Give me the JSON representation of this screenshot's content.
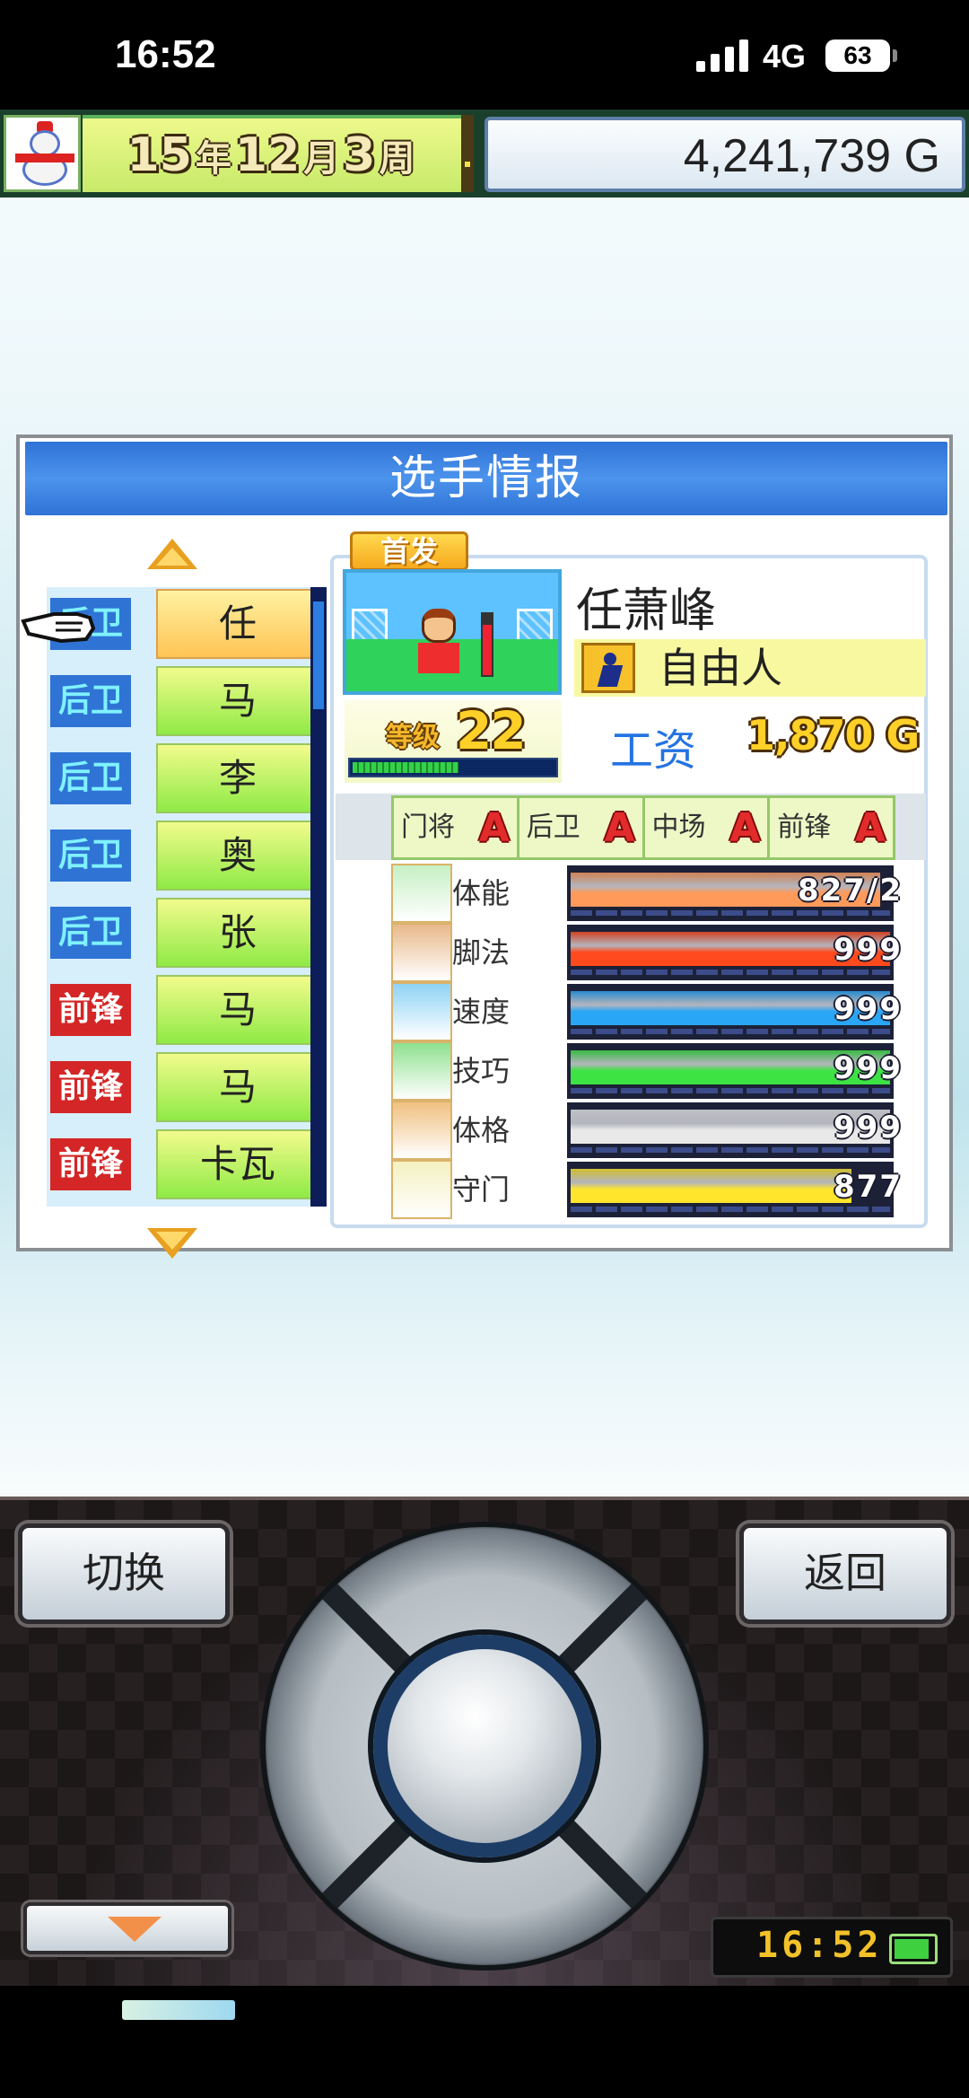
{
  "status_bar": {
    "time": "16:52",
    "network": "4G",
    "battery": "63"
  },
  "top_bar": {
    "year_num": "15",
    "year_unit": "年",
    "month_num": "12",
    "month_unit": "月",
    "week_num": "3",
    "week_unit": "周",
    "money": "4,241,739 G",
    "avatar_icon": "snowman-avatar-icon"
  },
  "window": {
    "title": "选手情报"
  },
  "roster": [
    {
      "position": "后卫",
      "name": "任",
      "type": "def",
      "selected": true
    },
    {
      "position": "后卫",
      "name": "马",
      "type": "def",
      "selected": false
    },
    {
      "position": "后卫",
      "name": "李",
      "type": "def",
      "selected": false
    },
    {
      "position": "后卫",
      "name": "奥",
      "type": "def",
      "selected": false
    },
    {
      "position": "后卫",
      "name": "张",
      "type": "def",
      "selected": false
    },
    {
      "position": "前锋",
      "name": "马",
      "type": "fwd",
      "selected": false
    },
    {
      "position": "前锋",
      "name": "马",
      "type": "fwd",
      "selected": false
    },
    {
      "position": "前锋",
      "name": "卡瓦",
      "type": "fwd",
      "selected": false
    }
  ],
  "player": {
    "tag": "首发",
    "name": "任萧峰",
    "status": "自由人",
    "level_label": "等级",
    "level": "22",
    "xp_progress": 0.52,
    "salary_label": "工资",
    "salary": "1,870",
    "salary_unit": "G",
    "aptitudes": [
      {
        "name": "门将",
        "grade": "A"
      },
      {
        "name": "后卫",
        "grade": "A"
      },
      {
        "name": "中场",
        "grade": "A"
      },
      {
        "name": "前锋",
        "grade": "A"
      }
    ],
    "stats": [
      {
        "label": "体能",
        "value": "827/2",
        "fill": 0.97,
        "color": "#ff9a5a",
        "icon": "battery-icon"
      },
      {
        "label": "脚法",
        "value": "999",
        "fill": 1.0,
        "color": "#ff4a1e",
        "icon": "shoe-icon"
      },
      {
        "label": "速度",
        "value": "999",
        "fill": 1.0,
        "color": "#29a6f5",
        "icon": "runner-icon"
      },
      {
        "label": "技巧",
        "value": "999",
        "fill": 1.0,
        "color": "#3de243",
        "icon": "dribble-icon"
      },
      {
        "label": "体格",
        "value": "999",
        "fill": 1.0,
        "color": "#e8e8e8",
        "icon": "muscle-icon"
      },
      {
        "label": "守门",
        "value": "877",
        "fill": 0.88,
        "color": "#ffe52c",
        "icon": "glove-icon"
      }
    ]
  },
  "controls": {
    "switch_label": "切换",
    "back_label": "返回",
    "clock": "16:52"
  },
  "colors": {
    "header_blue": "#2f73d6",
    "defender_badge": "#2f74d4",
    "forward_badge": "#d42626",
    "grade_red": "#e22b2b"
  }
}
